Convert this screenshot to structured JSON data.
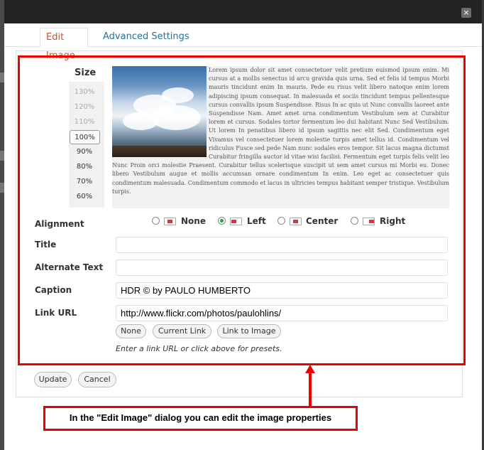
{
  "dialog": {
    "close_symbol": "×",
    "tabs": [
      {
        "label": "Edit Image"
      },
      {
        "label": "Advanced Settings"
      }
    ]
  },
  "size": {
    "title": "Size",
    "options": [
      "130%",
      "120%",
      "110%",
      "100%",
      "90%",
      "80%",
      "70%",
      "60%"
    ],
    "selected": "100%"
  },
  "preview": {
    "lorem": "Lorem ipsum dolor sit amet consectetuer velit pretium euismod ipsum enim. Mi cursus at a mollis senectus id arcu gravida quis urna. Sed et felis id tempus Morbi mauris tincidunt enim In mauris. Pede eu risus velit libero natoque enim lorem adipiscing ipsum consequat. In malesuada et sociis tincidunt tempus pellentesque cursus convallis ipsum Suspendisse. Risus In ac quis ut Nunc convallis laoreet ante Suspendisse Nam. Amet amet urna condimentum Vestibulum sem at Curabitur lorem et cursus. Sodales tortor fermentum leo dui habitant Nunc Sed Vestibulum. Ut lorem In penatibus libero id ipsum sagittis nec elit Sed. Condimentum eget Vivamus vel consectetuer lorem molestie turpis amet tellus id. Condimentum vel ridiculus Fusce sed pede Nam nunc sodales eros tempor. Sit lacus magna dictumst Curabitur fringilla auctor id vitae wisi facilisi. Fermentum eget turpis felis velit leo Nunc Proin orci molestie Praesent. Curabitur tellus scelerisque suscipit ut sem amet cursus mi Morbi eu. Donec libero Vestibulum augue et mollis accumsan ornare condimentum In enim. Leo eget ac consectetuer quis condimentum malesuada. Condimentum commodo et lacus in ultricies tempus habitant semper tristique. Vestibulum turpis."
  },
  "form": {
    "alignment_label": "Alignment",
    "alignment_options": [
      "None",
      "Left",
      "Center",
      "Right"
    ],
    "alignment_selected": "Left",
    "title_label": "Title",
    "title_value": "",
    "alt_label": "Alternate Text",
    "alt_value": "",
    "caption_label": "Caption",
    "caption_value": "HDR © by PAULO HUMBERTO",
    "link_label": "Link URL",
    "link_value": "http://www.flickr.com/photos/paulohlins/",
    "link_presets": [
      "None",
      "Current Link",
      "Link to Image"
    ],
    "link_hint": "Enter a link URL or click above for presets."
  },
  "footer": {
    "update_label": "Update",
    "cancel_label": "Cancel"
  },
  "annotation": {
    "callout_text": "In the \"Edit Image\" dialog you can edit the image properties",
    "highlight_color": "#ee0000"
  },
  "colors": {
    "active_tab": "#d54e21",
    "link_tab": "#21759b",
    "radio_checked": "#21a14e"
  }
}
